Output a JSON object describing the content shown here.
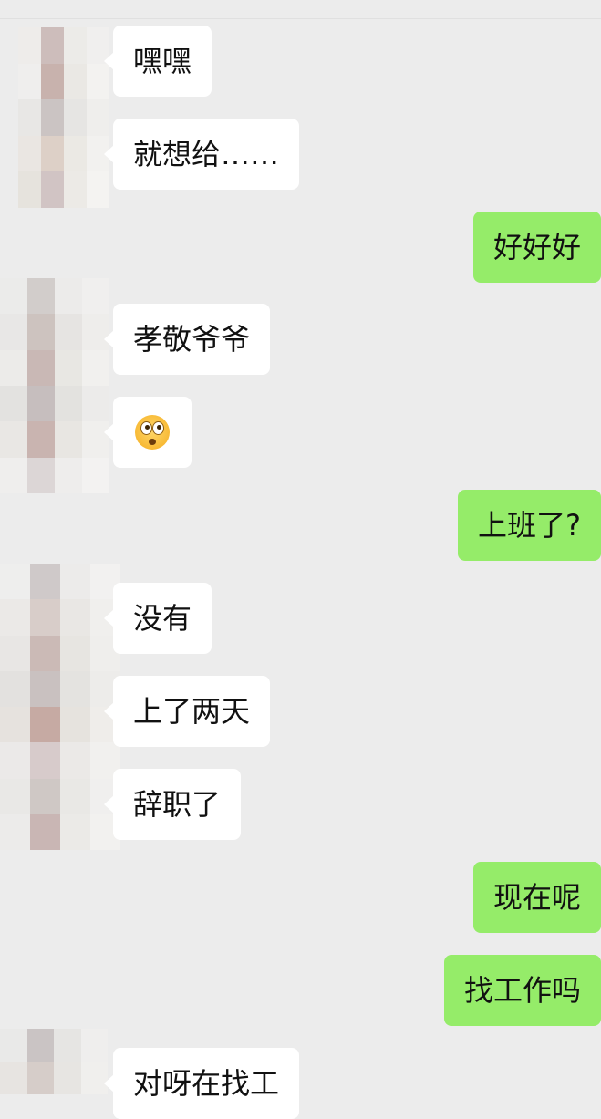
{
  "conversation": {
    "messages": [
      {
        "side": "in",
        "text": "嘿嘿"
      },
      {
        "side": "in",
        "text": "就想给……"
      },
      {
        "side": "out",
        "text": "好好好"
      },
      {
        "side": "in",
        "text": "孝敬爷爷"
      },
      {
        "side": "in",
        "text": "",
        "emoji": "flushed-face-emoji"
      },
      {
        "side": "out",
        "text": "上班了?"
      },
      {
        "side": "in",
        "text": "没有"
      },
      {
        "side": "in",
        "text": "上了两天"
      },
      {
        "side": "in",
        "text": "辞职了"
      },
      {
        "side": "out",
        "text": "现在呢"
      },
      {
        "side": "out",
        "text": "找工作吗"
      },
      {
        "side": "in",
        "text": "对呀在找工"
      }
    ]
  },
  "colors": {
    "background": "#ececec",
    "incoming_bubble": "#ffffff",
    "outgoing_bubble": "#95ec69"
  }
}
